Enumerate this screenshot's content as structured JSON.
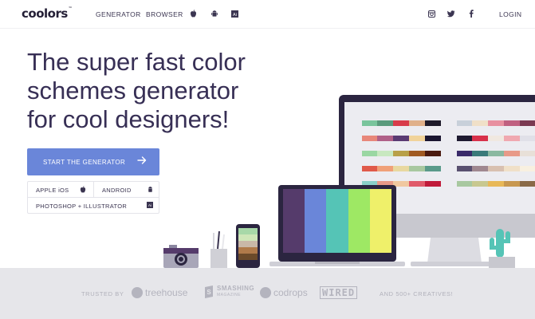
{
  "nav": {
    "logo": "coolors",
    "logo_mark": "™",
    "generator": "GENERATOR",
    "browser": "BROWSER",
    "login": "LOGIN",
    "icons": [
      "apple-icon",
      "android-icon",
      "adobe-icon",
      "instagram-icon",
      "twitter-icon",
      "facebook-icon"
    ]
  },
  "hero": {
    "headline_1": "The super fast color",
    "headline_2": "schemes generator",
    "headline_3": "for cool designers!",
    "cta_label": "START THE GENERATOR",
    "platforms": {
      "ios": "APPLE iOS",
      "android": "ANDROID",
      "adobe": "PHOTOSHOP + ILLUSTRATOR"
    }
  },
  "footer": {
    "trusted_by": "TRUSTED BY",
    "brands": [
      "treehouse",
      "SMASHING",
      "codrops",
      "WIRED"
    ],
    "smashing_sub": "MAGAZINE",
    "more": "AND 500+ CREATIVES!"
  },
  "colors": {
    "accent": "#6a86d9",
    "heading": "#372f55",
    "laptop_palette": [
      "#553b6b",
      "#6a86d9",
      "#55c4b6",
      "#9ee864",
      "#eff06a"
    ],
    "phone_palette": [
      "#a8d8a8",
      "#cfe6b8",
      "#c9b8a8",
      "#b07a4a",
      "#6b4a2a"
    ]
  }
}
